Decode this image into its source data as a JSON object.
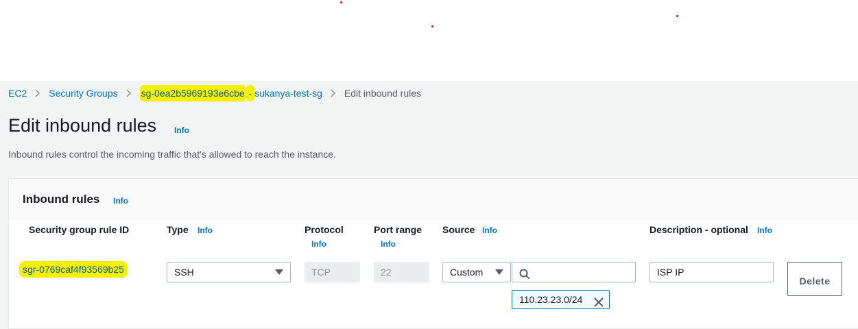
{
  "breadcrumb": {
    "items": [
      "EC2",
      "Security Groups"
    ],
    "sg_id": "sg-0ea2b5969193e6cbe",
    "sg_separator": " - ",
    "sg_name": "sukanya-test-sg",
    "current": "Edit inbound rules"
  },
  "page": {
    "title": "Edit inbound rules",
    "info": "Info",
    "description": "Inbound rules control the incoming traffic that's allowed to reach the instance."
  },
  "panel": {
    "title": "Inbound rules",
    "info": "Info",
    "columns": {
      "rule_id": "Security group rule ID",
      "type": "Type",
      "type_info": "Info",
      "protocol": "Protocol",
      "protocol_info": "Info",
      "port_range": "Port range",
      "port_range_info": "Info",
      "source": "Source",
      "source_info": "Info",
      "description": "Description - optional",
      "description_info": "Info"
    },
    "rows": [
      {
        "rule_id": "sgr-0769caf4f93569b25",
        "type": "SSH",
        "protocol": "TCP",
        "port_range": "22",
        "source_type": "Custom",
        "source_search": "",
        "source_token": "110.23.23.0/24",
        "description": "ISP IP",
        "delete_label": "Delete"
      }
    ]
  },
  "colors": {
    "link": "#0073bb",
    "highlight": "#f5f005",
    "background": "#f2f3f3"
  }
}
